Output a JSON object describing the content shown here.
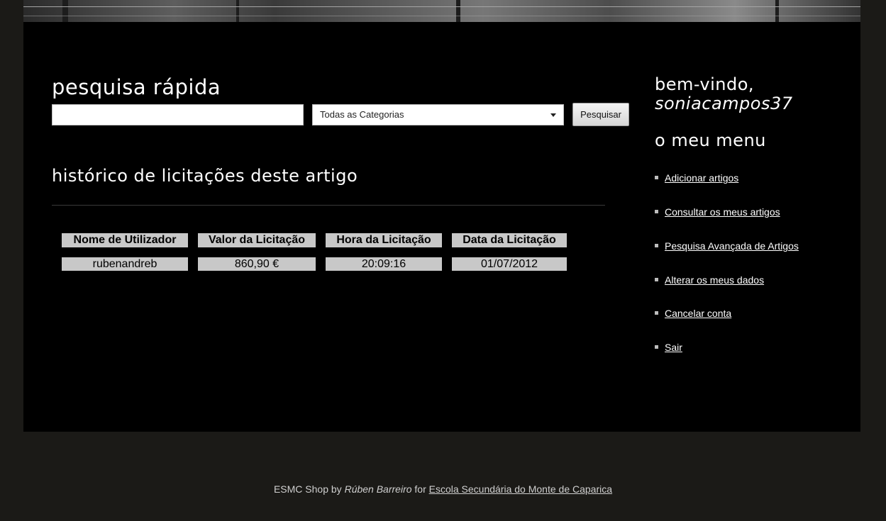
{
  "quick_search": {
    "title": "pesquisa rápida",
    "input_value": "",
    "category_selected": "Todas as Categorias",
    "button_label": "Pesquisar"
  },
  "history": {
    "title": "histórico de licitações deste artigo",
    "columns": [
      "Nome de Utilizador",
      "Valor da Licitação",
      "Hora da Licitação",
      "Data da Licitação"
    ],
    "rows": [
      [
        "rubenandreb",
        "860,90 €",
        "20:09:16",
        "01/07/2012"
      ]
    ]
  },
  "sidebar": {
    "welcome": "bem-vindo,",
    "username": "soniacampos37",
    "menu_title": "o meu menu",
    "items": [
      {
        "label": "Adicionar artigos"
      },
      {
        "label": "Consultar os meus artigos"
      },
      {
        "label": "Pesquisa Avançada de Artigos"
      },
      {
        "label": "Alterar os meus dados"
      },
      {
        "label": "Cancelar conta"
      },
      {
        "label": "Sair"
      }
    ]
  },
  "footer": {
    "prefix": "ESMC Shop by",
    "author": "Rúben Barreiro",
    "for_text": "for",
    "school_link": "Escola Secundária do Monte de Caparica"
  },
  "colors": {
    "page_bg": "#1b1a17",
    "panel_bg": "#000000",
    "table_cell_bg": "#c8c8c8"
  }
}
